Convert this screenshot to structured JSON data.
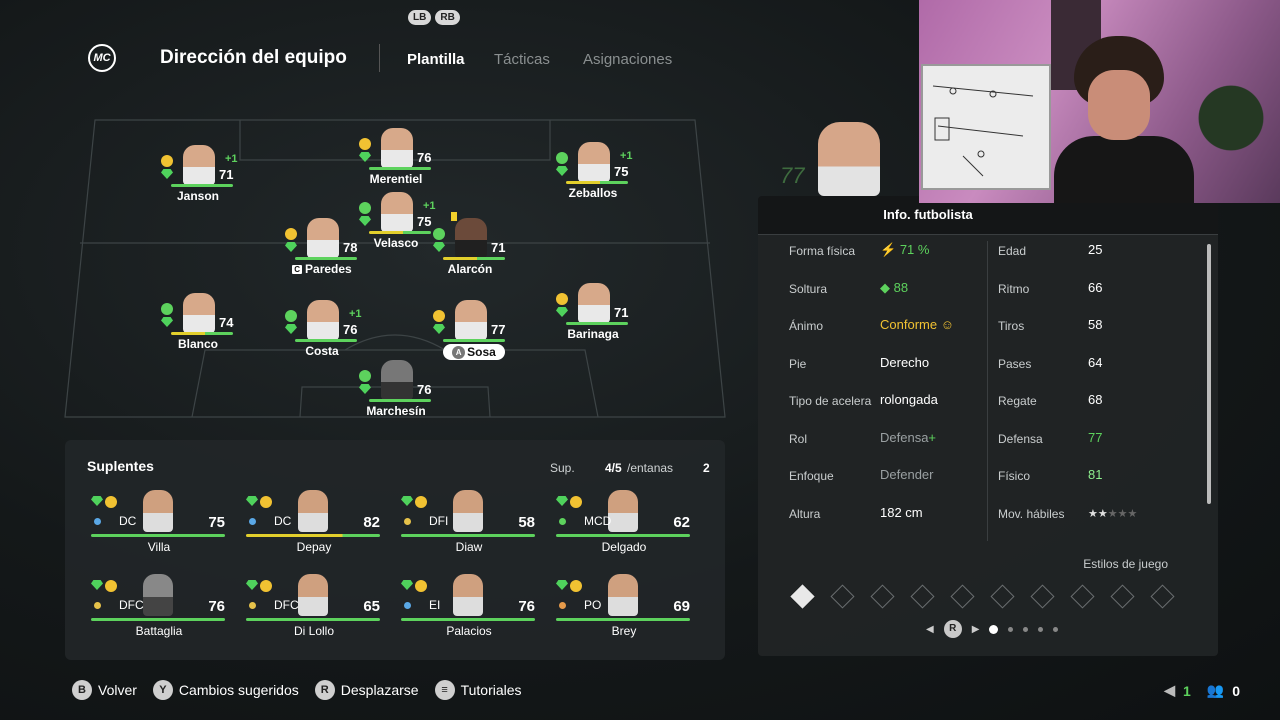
{
  "header": {
    "lb": "LB",
    "rb": "RB",
    "logo_text": "MC",
    "title": "Dirección del equipo",
    "tabs": [
      "Plantilla",
      "Tácticas",
      "Asignaciones"
    ],
    "active_tab": 0
  },
  "pitch_players": [
    {
      "name": "Janson",
      "rating": "71",
      "plus": "+1",
      "mood": "yellow",
      "bar": "green"
    },
    {
      "name": "Merentiel",
      "rating": "76",
      "plus": "",
      "mood": "yellow",
      "bar": "green"
    },
    {
      "name": "Zeballos",
      "rating": "75",
      "plus": "+1",
      "mood": "green",
      "bar": "yellow"
    },
    {
      "name": "Velasco",
      "rating": "75",
      "plus": "+1",
      "mood": "green",
      "bar": "yellow"
    },
    {
      "name": "Paredes",
      "rating": "78",
      "plus": "",
      "mood": "yellow",
      "bar": "green",
      "badge": "C"
    },
    {
      "name": "Alarcón",
      "rating": "71",
      "plus": "",
      "mood": "green",
      "bar": "yellow",
      "card": "yellow"
    },
    {
      "name": "Blanco",
      "rating": "74",
      "plus": "",
      "mood": "green",
      "bar": "yellow"
    },
    {
      "name": "Costa",
      "rating": "76",
      "plus": "+1",
      "mood": "green",
      "bar": "green"
    },
    {
      "name": "Sosa",
      "rating": "77",
      "plus": "",
      "mood": "yellow",
      "bar": "green",
      "badge": "A",
      "selected": true
    },
    {
      "name": "Barinaga",
      "rating": "71",
      "plus": "",
      "mood": "yellow",
      "bar": "green"
    },
    {
      "name": "Marchesín",
      "rating": "76",
      "plus": "",
      "mood": "green",
      "bar": "green"
    }
  ],
  "subs": {
    "title": "Suplentes",
    "sup_label": "Sup.",
    "sup_count": "4/5",
    "ventanas_label": "/entanas",
    "ventanas_count": "2",
    "players": [
      {
        "pos": "DC",
        "name": "Villa",
        "rating": "75",
        "dot": "#5aa8e6",
        "bar": "green"
      },
      {
        "pos": "DC",
        "name": "Depay",
        "rating": "82",
        "dot": "#5aa8e6",
        "bar": "yellow"
      },
      {
        "pos": "DFI",
        "name": "Diaw",
        "rating": "58",
        "dot": "#e6c24a",
        "bar": "green"
      },
      {
        "pos": "MCD",
        "name": "Delgado",
        "rating": "62",
        "dot": "#5dd25d",
        "bar": "green"
      },
      {
        "pos": "DFC",
        "name": "Battaglia",
        "rating": "76",
        "dot": "#e6c24a",
        "bar": "green"
      },
      {
        "pos": "DFC",
        "name": "Di Lollo",
        "rating": "65",
        "dot": "#e6c24a",
        "bar": "green"
      },
      {
        "pos": "EI",
        "name": "Palacios",
        "rating": "76",
        "dot": "#5aa8e6",
        "bar": "green"
      },
      {
        "pos": "PO",
        "name": "Brey",
        "rating": "69",
        "dot": "#e69a4a",
        "bar": "green"
      }
    ]
  },
  "hero": {
    "rating": "77"
  },
  "info": {
    "title": "Info. futbolista",
    "left": [
      {
        "label": "Forma física",
        "value": "71 %"
      },
      {
        "label": "Soltura",
        "value": "88"
      },
      {
        "label": "Ánimo",
        "value": "Conforme"
      },
      {
        "label": "Pie",
        "value": "Derecho"
      },
      {
        "label": "Tipo de acelera",
        "value": "rolongada"
      },
      {
        "label": "Rol",
        "value": "Defensa"
      },
      {
        "label": "Enfoque",
        "value": "Defender"
      },
      {
        "label": "Altura",
        "value": "182 cm"
      }
    ],
    "right": [
      {
        "label": "Edad",
        "value": "25"
      },
      {
        "label": "Ritmo",
        "value": "66"
      },
      {
        "label": "Tiros",
        "value": "58"
      },
      {
        "label": "Pases",
        "value": "64"
      },
      {
        "label": "Regate",
        "value": "68"
      },
      {
        "label": "Defensa",
        "value": "77"
      },
      {
        "label": "Físico",
        "value": "81"
      },
      {
        "label": "Mov. hábiles",
        "value": "★★★★★"
      }
    ],
    "skill_moves_stars": 2,
    "rol_plus": "+",
    "playstyles_title": "Estilos de juego",
    "pager_button": "R"
  },
  "bottom_bar": [
    {
      "button": "B",
      "label": "Volver"
    },
    {
      "button": "Y",
      "label": "Cambios sugeridos"
    },
    {
      "button": "R",
      "label": "Desplazarse"
    },
    {
      "button": "≡",
      "label": "Tutoriales"
    }
  ],
  "counts": {
    "left": "1",
    "right": "0"
  }
}
